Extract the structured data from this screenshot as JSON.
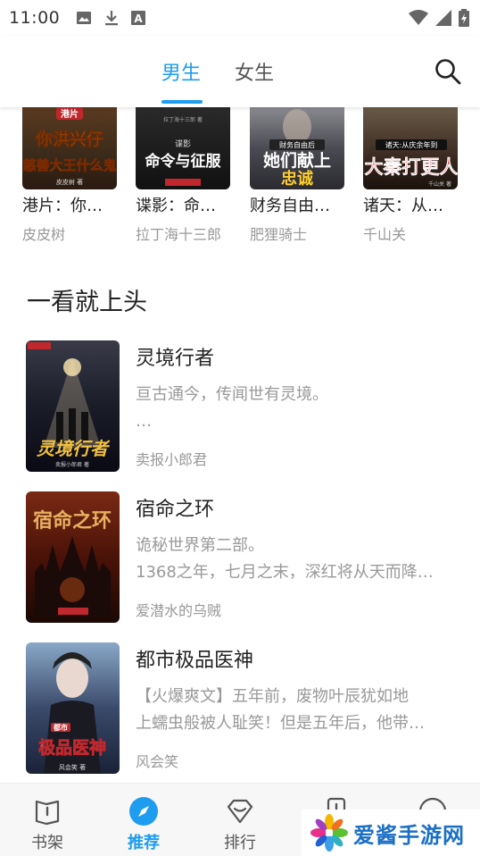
{
  "status_bar": {
    "time": "11:00",
    "left_icons": [
      "image-icon",
      "download-icon",
      "font-icon"
    ],
    "right_icons": [
      "wifi-icon",
      "signal-icon",
      "battery-icon"
    ]
  },
  "header": {
    "tabs": [
      {
        "label": "男生",
        "active": true
      },
      {
        "label": "女生",
        "active": false
      }
    ],
    "search_icon": "search-icon"
  },
  "top_books": [
    {
      "title": "港片：你…",
      "author": "皮皮树",
      "cover_text": "你洪兴仔\n慈善大王什么鬼",
      "cover_badge": "港片",
      "cover_color": "#3a2a1a"
    },
    {
      "title": "谍影：命…",
      "author": "拉丁海十三郎",
      "cover_text": "命令与征服",
      "cover_badge": "谍影",
      "cover_color": "#1a1a1a"
    },
    {
      "title": "财务自由…",
      "author": "肥狸骑士",
      "cover_text": "她们献上忠诚",
      "cover_badge": "",
      "cover_color": "#4a4a52"
    },
    {
      "title": "诸天：从…",
      "author": "千山关",
      "cover_text": "大秦打更人",
      "cover_badge": "诸天:从庆余年到",
      "cover_color": "#2a2018"
    }
  ],
  "section": {
    "title": "一看就上头"
  },
  "books": [
    {
      "title": "灵境行者",
      "desc_line1": "亘古通今，传闻世有灵境。",
      "desc_line2": "…",
      "author": "卖报小郎君",
      "cover_text": "灵境行者",
      "cover_color": "#1a2030"
    },
    {
      "title": "宿命之环",
      "desc_line1": "诡秘世界第二部。",
      "desc_line2": "1368之年，七月之末，深红将从天而降…",
      "author": "爱潜水的乌贼",
      "cover_text": "宿命之环",
      "cover_color": "#5a1a10"
    },
    {
      "title": "都市极品医神",
      "desc_line1": "【火爆爽文】五年前，废物叶辰犹如地",
      "desc_line2": "上蠕虫般被人耻笑！但是五年后，他带…",
      "author": "风会笑",
      "cover_text": "极品医神",
      "cover_badge": "都市",
      "cover_color": "#2a3a5a"
    }
  ],
  "bottom_nav": [
    {
      "label": "书架",
      "icon": "bookshelf-icon",
      "active": false
    },
    {
      "label": "推荐",
      "icon": "compass-icon",
      "active": true
    },
    {
      "label": "排行",
      "icon": "ranking-icon",
      "active": false
    },
    {
      "label": "",
      "icon": "category-icon",
      "active": false
    },
    {
      "label": "",
      "icon": "profile-icon",
      "active": false
    }
  ],
  "watermark": {
    "text": "爱酱手游网"
  },
  "colors": {
    "accent": "#1e9cf0",
    "text_primary": "#222222",
    "text_secondary": "#999999"
  }
}
